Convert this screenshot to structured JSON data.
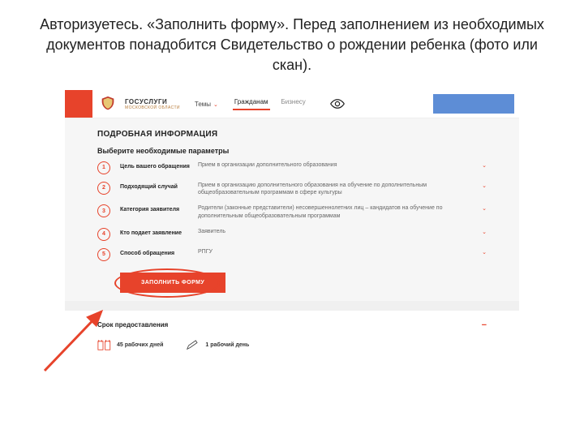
{
  "instruction": "Авторизуетесь. «Заполнить форму». Перед заполнением из необходимых документов понадобится Свидетельство о рождении ребенка (фото или скан).",
  "brand": {
    "title": "ГОСУСЛУГИ",
    "sub": "МОСКОВСКОЙ ОБЛАСТИ"
  },
  "topnav": {
    "themes": "Темы",
    "tabs": {
      "citizens": "Гражданам",
      "business": "Бизнесу"
    }
  },
  "section": {
    "title": "ПОДРОБНАЯ ИНФОРМАЦИЯ",
    "prompt": "Выберите необходимые параметры",
    "rows": [
      {
        "num": "1",
        "label": "Цель вашего обращения",
        "value": "Прием в организации дополнительного образования"
      },
      {
        "num": "2",
        "label": "Подходящий случай",
        "value": "Прием в организацию дополнительного образования на обучение по дополнительным общеобразовательным программам в сфере культуры"
      },
      {
        "num": "3",
        "label": "Категория заявителя",
        "value": "Родители (законные представители) несовершеннолетних лиц – кандидатов на обучение по дополнительным общеобразовательным программам"
      },
      {
        "num": "4",
        "label": "Кто подает заявление",
        "value": "Заявитель"
      },
      {
        "num": "5",
        "label": "Способ обращения",
        "value": "РПГУ"
      }
    ]
  },
  "button": "ЗАПОЛНИТЬ ФОРМУ",
  "delivery": {
    "title": "Срок предоставления",
    "items": [
      "45 рабочих дней",
      "1 рабочий день"
    ]
  }
}
